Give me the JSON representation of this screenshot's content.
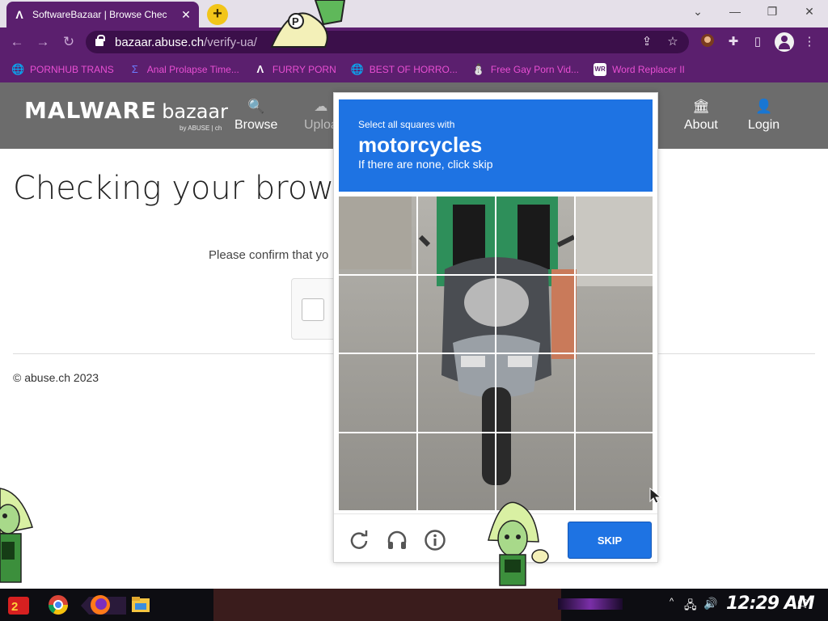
{
  "browser": {
    "tab": {
      "title": "SoftwareBazaar | Browse Chec",
      "favicon": "Λ",
      "close": "✕"
    },
    "newtab_label": "+",
    "window_controls": {
      "dropdown": "⌄",
      "minimize": "—",
      "restore": "❐",
      "close": "✕"
    },
    "nav": {
      "back": "←",
      "forward": "→",
      "reload": "↻"
    },
    "url": {
      "host": "bazaar.abuse.ch",
      "path": "/verify-ua/"
    },
    "bookmarks": [
      {
        "icon": "globe-icon",
        "glyph": "🌐",
        "label": "PORNHUB TRANS"
      },
      {
        "icon": "sigma-icon",
        "glyph": "Σ",
        "label": "Anal Prolapse Time..."
      },
      {
        "icon": "lambda-icon",
        "glyph": "Λ",
        "label": "FURRY PORN"
      },
      {
        "icon": "globe-icon",
        "glyph": "🌐",
        "label": "BEST OF HORRO..."
      },
      {
        "icon": "mask-icon",
        "glyph": "⛄",
        "label": "Free Gay Porn Vid..."
      },
      {
        "icon": "wr-icon",
        "glyph": "WR",
        "label": "Word Replacer II"
      }
    ]
  },
  "site": {
    "logo_main": "MALWARE",
    "logo_sub": "bazaar",
    "logo_by": "by ABUSE | ch",
    "nav": [
      {
        "label": "Browse",
        "glyph": "🔍"
      },
      {
        "label": "Uploa",
        "glyph": "☁"
      },
      {
        "label": "About",
        "glyph": "🏛"
      },
      {
        "label": "Login",
        "glyph": "👤"
      }
    ],
    "heading": "Checking your browser",
    "confirm_text": "Please confirm that yo",
    "copyright": "© abuse.ch 2023"
  },
  "captcha": {
    "prompt": "Select all squares with",
    "target": "motorcycles",
    "hint": "If there are none, click skip",
    "skip_label": "SKIP",
    "tiles": 16,
    "accent": "#1e73e3"
  },
  "taskbar": {
    "clock": "12:29 AM",
    "tray": {
      "chevron": "^",
      "network": "🖧",
      "volume": "🔊",
      "notify": "🗨"
    }
  },
  "colors": {
    "chrome": "#5b1f6e",
    "bookmark_text": "#e84fd3",
    "header": "#6c6c6c"
  }
}
